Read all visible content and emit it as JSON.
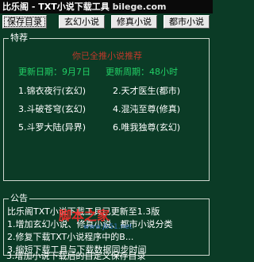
{
  "window": {
    "title": "比乐阁 - TXT小说下载工具",
    "site": "bilege.com"
  },
  "toolbar": {
    "open_dir": "保存目录",
    "tab_xuanhuan": "玄幻小说",
    "tab_xiuzhen": "修真小说",
    "tab_dushi": "都市小说"
  },
  "recommend": {
    "legend": "特荐",
    "banner": "你已全推小说推荐",
    "update_date": "更新日期：9月7日",
    "update_cycle": "更新周期：48小时",
    "items": [
      {
        "label": "1.锦衣夜行(玄幻)"
      },
      {
        "label": "2.天才医生(都市)"
      },
      {
        "label": "3.斗破苍穹(玄幻)"
      },
      {
        "label": "4.混沌至尊(修真)"
      },
      {
        "label": "5.斗罗大陆(异界)"
      },
      {
        "label": "6.唯我独尊(玄幻)"
      }
    ]
  },
  "notice": {
    "legend": "公告",
    "lines": [
      "比乐阁TXT小说下载工具已更新至1.3版",
      "1.增加玄幻小说、修真小说、都市小说分类",
      "2.修复下载TXT小说程序中的B...",
      "3.缩短下载工具与下载数据同步时间",
      "3.增加小说下载后的自定义保存目录"
    ]
  },
  "watermark": {
    "text": "脚本之家",
    "url": "www.jb51.net"
  }
}
